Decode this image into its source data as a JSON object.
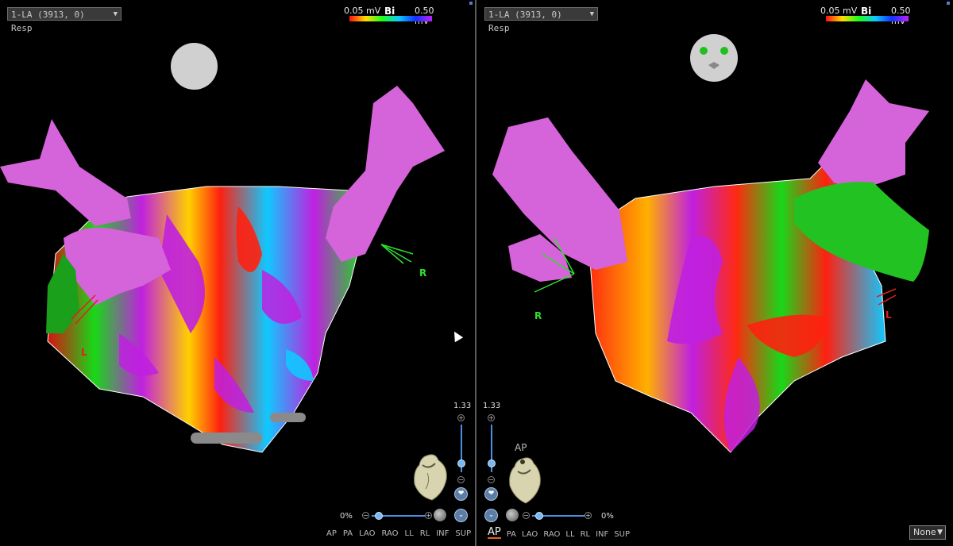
{
  "left": {
    "map_name": "1-LA (3913, 0) Resp",
    "legend": {
      "min": "0.05 mV",
      "mode": "Bi",
      "max": "0.50 mV"
    },
    "orientation_labels": {
      "right": "R",
      "left": "L"
    },
    "zoom": "1.33",
    "transparency": "0%",
    "views": [
      "AP",
      "PA",
      "LAO",
      "RAO",
      "LL",
      "RL",
      "INF",
      "SUP"
    ]
  },
  "right": {
    "map_name": "1-LA (3913, 0) Resp",
    "legend": {
      "min": "0.05 mV",
      "mode": "Bi",
      "max": "0.50 mV"
    },
    "orientation_labels": {
      "right": "R",
      "left": "L"
    },
    "zoom": "1.33",
    "heart_view_label": "AP",
    "transparency": "0%",
    "views": [
      "AP",
      "PA",
      "LAO",
      "RAO",
      "LL",
      "RL",
      "INF",
      "SUP"
    ],
    "active_view": "AP",
    "display_select": "None"
  },
  "colors": {
    "accent": "#4a90e2",
    "active_view_underline": "#e8601a",
    "label_green": "#2ee02e",
    "label_red": "#e02020"
  }
}
